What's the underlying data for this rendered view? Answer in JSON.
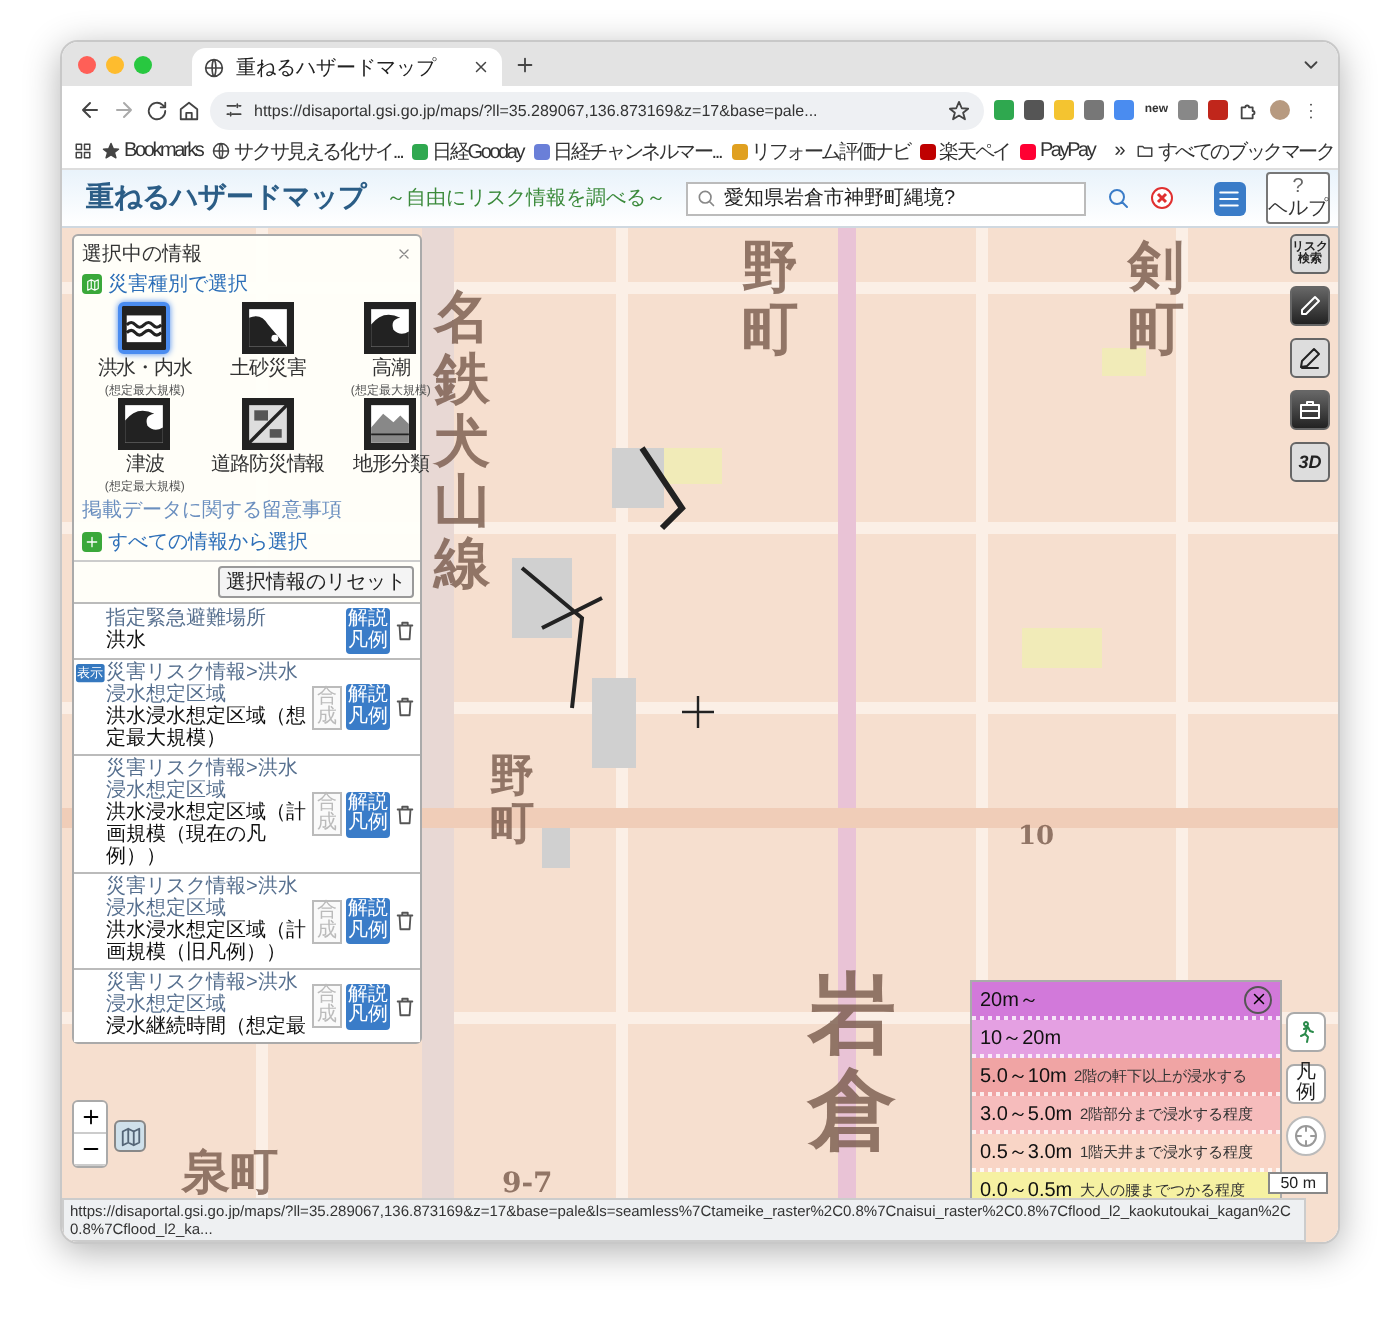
{
  "browser": {
    "tab_title": "重ねるハザードマップ",
    "address": "https://disaportal.gsi.go.jp/maps/?ll=35.289067,136.873169&z=17&base=pale...",
    "bookmarks": [
      {
        "label": "Bookmarks",
        "kind": "star"
      },
      {
        "label": "サクサ見える化サイ...",
        "kind": "globe"
      },
      {
        "label": "日経Gooday",
        "kind": "g"
      },
      {
        "label": "日経チャンネルマー...",
        "kind": "rainbow"
      },
      {
        "label": "リフォーム評価ナビ",
        "kind": "check"
      },
      {
        "label": "楽天ペイ",
        "kind": "r"
      },
      {
        "label": "PayPay",
        "kind": "p"
      }
    ],
    "more": "»",
    "folder": "すべてのブックマーク",
    "new_badge": "new"
  },
  "app": {
    "title": "重ねるハザードマップ",
    "subtitle": "～自由にリスク情報を調べる～",
    "search_value": "愛知県岩倉市神野町縄境?",
    "help_mark": "?",
    "help": "ヘルプ"
  },
  "tools": {
    "risk_search": "リスク検索",
    "three_d": "3D",
    "legend": "凡例",
    "scale": "50 m"
  },
  "map": {
    "labels": [
      {
        "text": "野町",
        "kind": "vertical"
      },
      {
        "text": "剣町",
        "kind": "vertical"
      },
      {
        "text": "名鉄犬山線",
        "kind": "vertical"
      },
      {
        "text": "野町",
        "kind": "vertical"
      },
      {
        "text": "岩倉",
        "kind": "vertical"
      },
      {
        "text": "泉町",
        "kind": "horizontal"
      },
      {
        "text": "10",
        "kind": "horizontal"
      },
      {
        "text": "9-7",
        "kind": "horizontal"
      }
    ]
  },
  "panel": {
    "title": "選択中の情報",
    "section": "災害種別で選択",
    "hazards": [
      {
        "label": "洪水・内水",
        "note": "(想定最大規模)",
        "selected": true,
        "kind": "flood"
      },
      {
        "label": "土砂災害",
        "selected": false,
        "kind": "landslide"
      },
      {
        "label": "高潮",
        "note": "(想定最大規模)",
        "selected": false,
        "kind": "surge"
      },
      {
        "label": "津波",
        "note": "(想定最大規模)",
        "selected": false,
        "kind": "tsunami"
      },
      {
        "label": "道路防災情報",
        "selected": false,
        "kind": "road"
      },
      {
        "label": "地形分類",
        "selected": false,
        "kind": "terrain"
      }
    ],
    "notice": "掲載データに関する留意事項",
    "all": "すべての情報から選択",
    "reset": "選択情報のリセット",
    "layers": [
      {
        "path": "指定緊急避難場所",
        "name": "洪水",
        "explain": "解説凡例"
      },
      {
        "badge": "表示",
        "path": "災害リスク情報>洪水浸水想定区域",
        "name": "洪水浸水想定区域（想定最大規模）",
        "combine": {
          "label": "合成",
          "disabled": true
        },
        "explain": "解説凡例"
      },
      {
        "path": "災害リスク情報>洪水浸水想定区域",
        "name": "洪水浸水想定区域（計画規模（現在の凡例））",
        "combine": {
          "label": "合成",
          "disabled": true
        },
        "explain": "解説凡例"
      },
      {
        "path": "災害リスク情報>洪水浸水想定区域",
        "name": "洪水浸水想定区域（計画規模（旧凡例））",
        "combine": {
          "label": "合成",
          "disabled": true
        },
        "explain": "解説凡例"
      },
      {
        "path": "災害リスク情報>洪水浸水想定区域",
        "name": "浸水継続時間（想定最",
        "combine": {
          "label": "合成",
          "disabled": true
        },
        "explain": "解説凡例"
      }
    ]
  },
  "legend": {
    "rows": [
      {
        "depth": "20m～",
        "color": "#d279da"
      },
      {
        "depth": "10～20m",
        "color": "#e4a0e2"
      },
      {
        "depth": "5.0～10m",
        "note": "2階の軒下以上が浸水する",
        "color": "#f0a4a4"
      },
      {
        "depth": "3.0～5.0m",
        "note": "2階部分まで浸水する程度",
        "color": "#f6bcbc"
      },
      {
        "depth": "0.5～3.0m",
        "note": "1階天井まで浸水する程度",
        "color": "#f9d5c6"
      },
      {
        "depth": "0.0～0.5m",
        "note": "大人の腰までつかる程度",
        "color": "#f6f1a2"
      }
    ]
  },
  "status_url": "https://disaportal.gsi.go.jp/maps/?ll=35.289067,136.873169&z=17&base=pale&ls=seamless%7Ctameike_raster%2C0.8%7Cnaisui_raster%2C0.8%7Cflood_l2_kaokutoukai_kagan%2C0.8%7Cflood_l2_ka..."
}
